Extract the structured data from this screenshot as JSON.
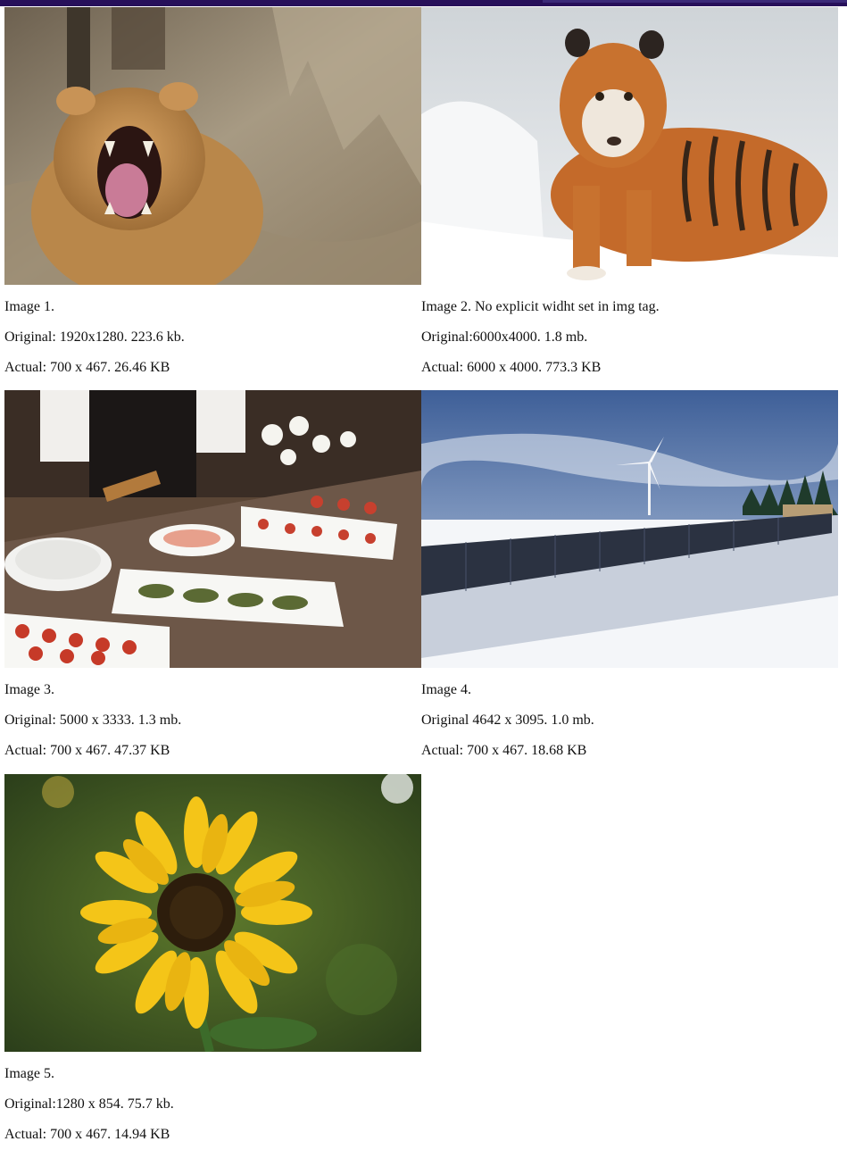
{
  "page": {
    "accent_color": "#27105a"
  },
  "images": [
    {
      "title": "Image 1.",
      "original": "Original: 1920x1280. 223.6 kb.",
      "actual": "Actual: 700 x 467. 26.46 KB",
      "subject": "lioness-roaring"
    },
    {
      "title": "Image 2. No explicit widht set in img tag.",
      "original": "Original:6000x4000. 1.8 mb.",
      "actual": "Actual: 6000 x 4000. 773.3 KB",
      "subject": "tiger-in-snow"
    },
    {
      "title": "Image 3.",
      "original": "Original: 5000 x 3333. 1.3 mb.",
      "actual": "Actual: 700 x 467. 47.37 KB",
      "subject": "catering-buffet-table"
    },
    {
      "title": "Image 4.",
      "original": "Original 4642 x 3095. 1.0 mb.",
      "actual": "Actual: 700 x 467. 18.68 KB",
      "subject": "solar-panels-wind-turbine-snow"
    },
    {
      "title": "Image 5.",
      "original": "Original:1280 x 854. 75.7 kb.",
      "actual": "Actual: 700 x 467. 14.94 KB",
      "subject": "sunflower"
    }
  ]
}
